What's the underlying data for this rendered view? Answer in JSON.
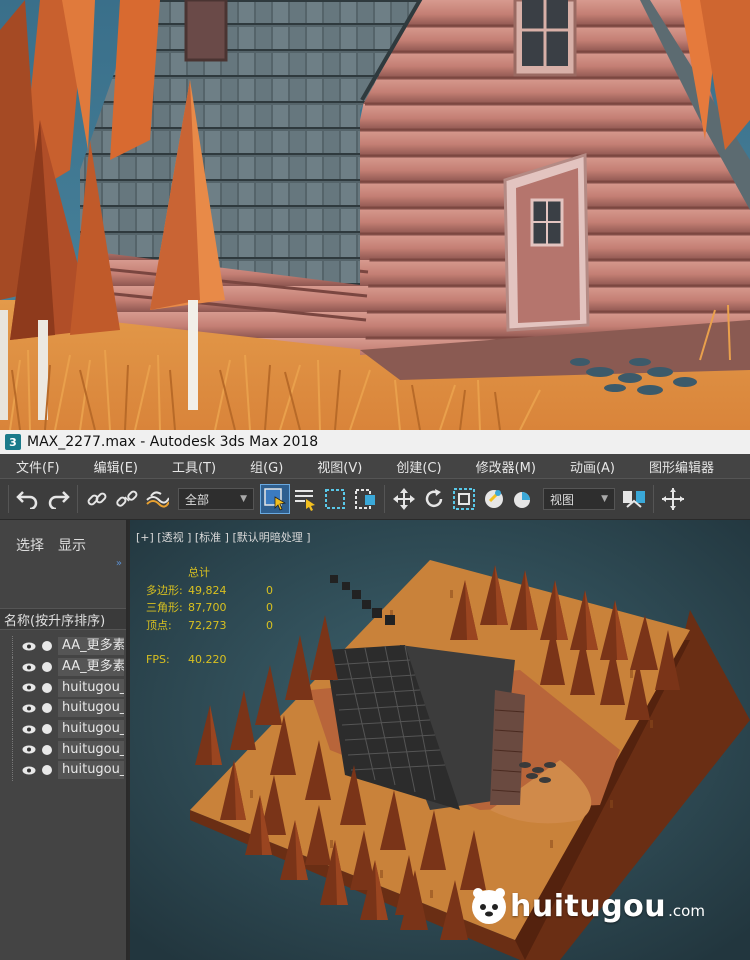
{
  "window": {
    "title": "MAX_2277.max - Autodesk 3ds Max 2018",
    "app_icon": "3"
  },
  "menubar": {
    "items": [
      {
        "label": "文件(F)"
      },
      {
        "label": "编辑(E)"
      },
      {
        "label": "工具(T)"
      },
      {
        "label": "组(G)"
      },
      {
        "label": "视图(V)"
      },
      {
        "label": "创建(C)"
      },
      {
        "label": "修改器(M)"
      },
      {
        "label": "动画(A)"
      },
      {
        "label": "图形编辑器"
      }
    ]
  },
  "toolbar": {
    "selection_filter": "全部",
    "reference_coord": "视图",
    "icons": [
      "undo-icon",
      "redo-icon",
      "link-icon",
      "unlink-icon",
      "bind-spacewarp-icon",
      "select-object-icon",
      "select-by-name-icon",
      "rect-selection-icon",
      "window-crossing-icon",
      "move-icon",
      "rotate-icon",
      "scale-icon",
      "snap-icon",
      "pivot-icon",
      "mirror-icon",
      "align-icon"
    ]
  },
  "scene_explorer": {
    "tabs": [
      "选择",
      "显示"
    ],
    "column_header": "名称(按升序排序)",
    "items": [
      {
        "name": "AA_更多素"
      },
      {
        "name": "AA_更多素"
      },
      {
        "name": "huitugou_"
      },
      {
        "name": "huitugou_"
      },
      {
        "name": "huitugou_"
      },
      {
        "name": "huitugou_"
      },
      {
        "name": "huitugou_"
      }
    ]
  },
  "viewport": {
    "label": "[+] [透视 ] [标准 ] [默认明暗处理 ]",
    "stats": {
      "header": "总计",
      "polygons_label": "多边形:",
      "polygons_value": "49,824",
      "polygons_sel": "0",
      "triangles_label": "三角形:",
      "triangles_value": "87,700",
      "triangles_sel": "0",
      "vertices_label": "顶点:",
      "vertices_value": "72,273",
      "vertices_sel": "0",
      "fps_label": "FPS:",
      "fps_value": "40.220"
    }
  },
  "watermark": {
    "text": "huitugou",
    "suffix": ".com"
  },
  "colors": {
    "accent_yellow": "#d8c020",
    "ui_dark": "#444444",
    "viewport_bg": "#33505a",
    "highlight_blue": "#2f5f8f"
  }
}
